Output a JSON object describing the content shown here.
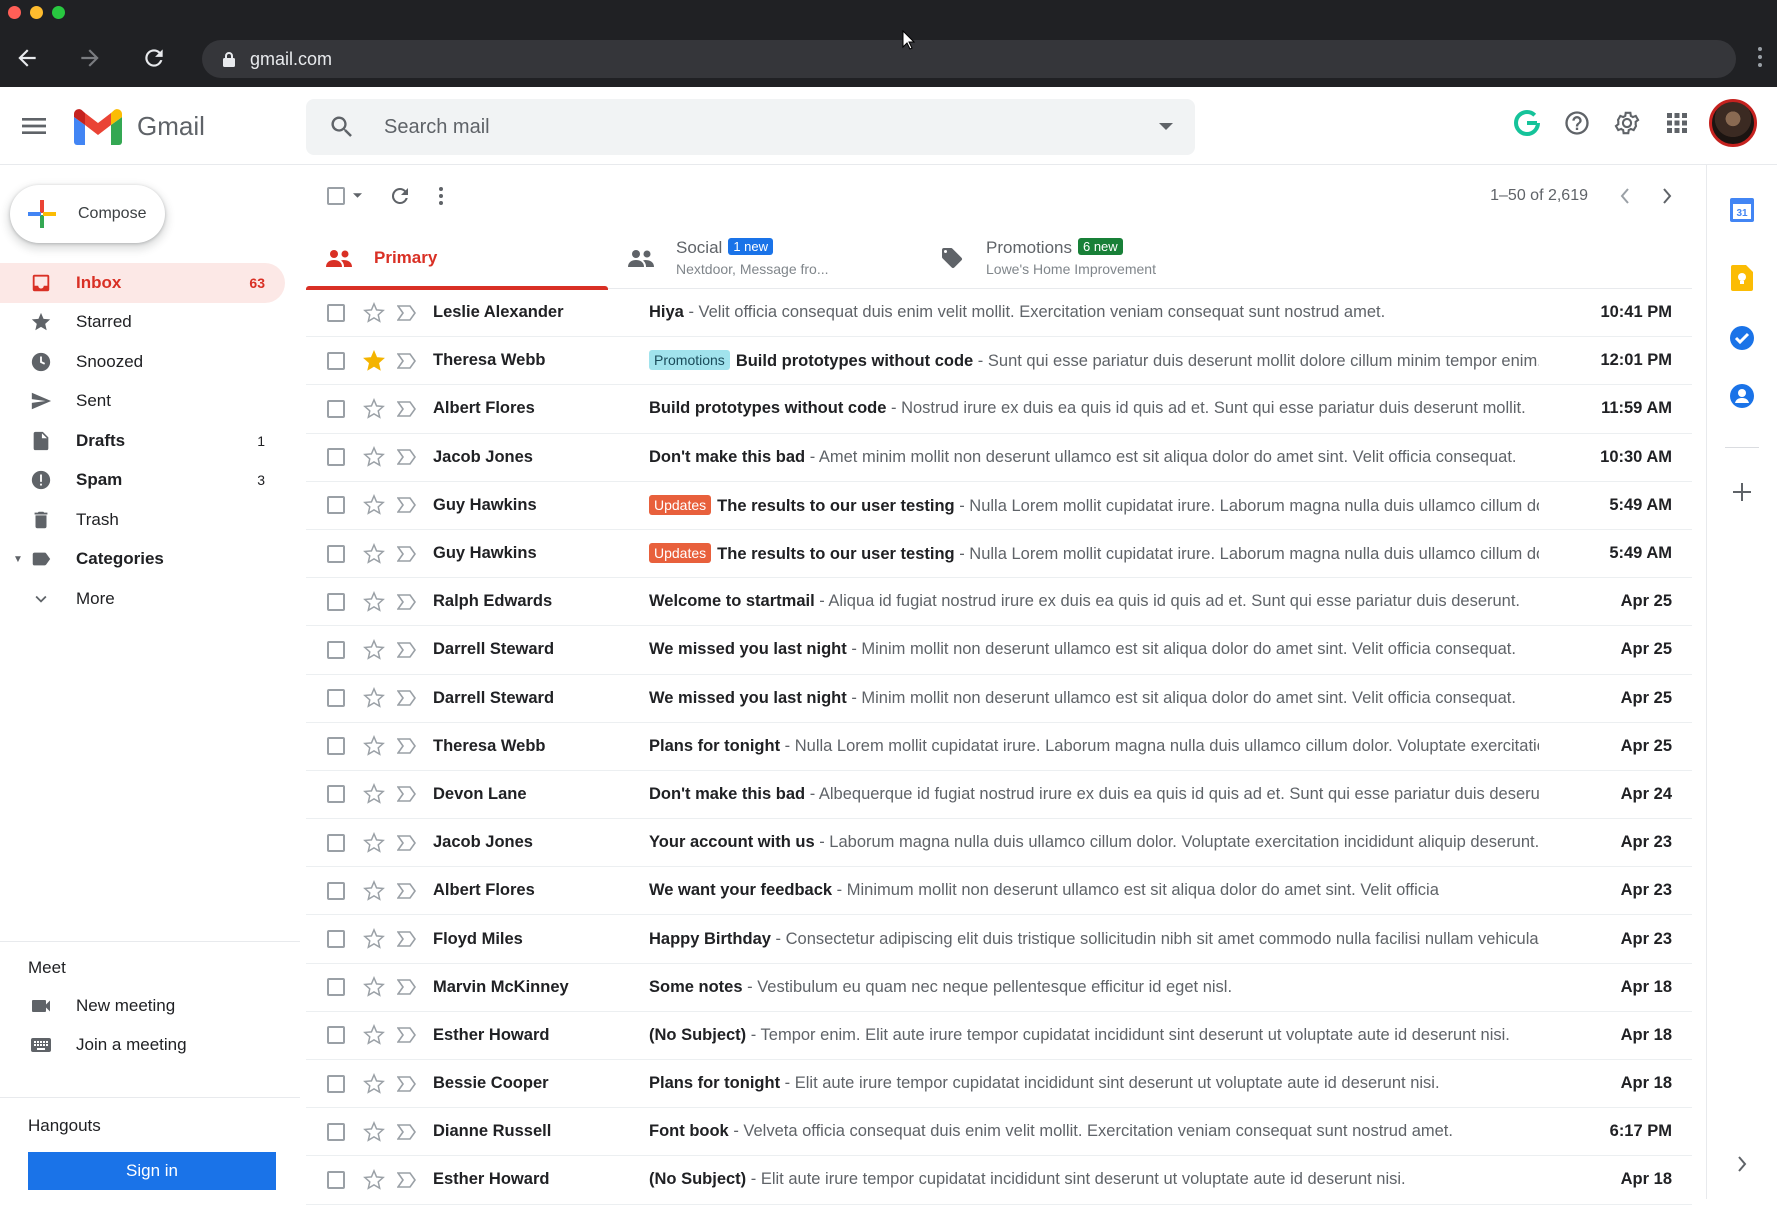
{
  "browser": {
    "url": "gmail.com"
  },
  "header": {
    "app_name": "Gmail",
    "search_placeholder": "Search mail"
  },
  "sidebar": {
    "compose_label": "Compose",
    "items": [
      {
        "label": "Inbox",
        "count": "63",
        "icon": "inbox-icon"
      },
      {
        "label": "Starred",
        "count": "",
        "icon": "star-icon"
      },
      {
        "label": "Snoozed",
        "count": "",
        "icon": "clock-icon"
      },
      {
        "label": "Sent",
        "count": "",
        "icon": "send-icon"
      },
      {
        "label": "Drafts",
        "count": "1",
        "icon": "file-icon"
      },
      {
        "label": "Spam",
        "count": "3",
        "icon": "alert-icon"
      },
      {
        "label": "Trash",
        "count": "",
        "icon": "trash-icon"
      },
      {
        "label": "Categories",
        "count": "",
        "icon": "label-icon"
      },
      {
        "label": "More",
        "count": "",
        "icon": "chevron-down-icon"
      }
    ],
    "meet": {
      "title": "Meet",
      "new_meeting": "New meeting",
      "join_meeting": "Join a meeting"
    },
    "hangouts": {
      "title": "Hangouts",
      "sign_in": "Sign in"
    }
  },
  "toolbar": {
    "pager": "1–50 of 2,619"
  },
  "tabs": {
    "primary": {
      "label": "Primary"
    },
    "social": {
      "label": "Social",
      "badge": "1 new",
      "sub": "Nextdoor, Message fro...",
      "badge_color": "#1a73e8"
    },
    "promotions": {
      "label": "Promotions",
      "badge": "6 new",
      "sub": "Lowe's Home Improvement",
      "badge_color": "#188038"
    }
  },
  "emails": [
    {
      "sender": "Leslie Alexander",
      "label": "",
      "subject": "Hiya",
      "snippet": " - Velit officia consequat duis enim velit mollit. Exercitation veniam consequat sunt nostrud amet.",
      "date": "10:41 PM",
      "starred": false
    },
    {
      "sender": "Theresa Webb",
      "label": "Promotions",
      "subject": "Build prototypes without code",
      "snippet": " - Sunt qui esse pariatur duis deserunt mollit dolore cillum minim tempor enim.",
      "date": "12:01 PM",
      "starred": true
    },
    {
      "sender": "Albert Flores",
      "label": "",
      "subject": "Build prototypes without code",
      "snippet": " - Nostrud irure ex duis ea quis id quis ad et. Sunt qui esse pariatur duis deserunt mollit.",
      "date": "11:59 AM",
      "starred": false
    },
    {
      "sender": "Jacob Jones",
      "label": "",
      "subject": "Don't make this bad",
      "snippet": " - Amet minim mollit non deserunt ullamco est sit aliqua dolor do amet sint. Velit officia consequat.",
      "date": "10:30 AM",
      "starred": false
    },
    {
      "sender": "Guy Hawkins",
      "label": "Updates",
      "subject": "The results to our user testing",
      "snippet": " - Nulla Lorem mollit cupidatat irure. Laborum magna nulla duis ullamco cillum dolor.",
      "date": "5:49 AM",
      "starred": false
    },
    {
      "sender": "Guy Hawkins",
      "label": "Updates",
      "subject": "The results to our user testing",
      "snippet": " - Nulla Lorem mollit cupidatat irure. Laborum magna nulla duis ullamco cillum dolor.",
      "date": "5:49 AM",
      "starred": false
    },
    {
      "sender": "Ralph Edwards",
      "label": "",
      "subject": "Welcome to startmail",
      "snippet": " - Aliqua id fugiat nostrud irure ex duis ea quis id quis ad et. Sunt qui esse pariatur duis deserunt.",
      "date": "Apr 25",
      "starred": false
    },
    {
      "sender": "Darrell Steward",
      "label": "",
      "subject": "We missed you last night",
      "snippet": " - Minim mollit non deserunt ullamco est sit aliqua dolor do amet sint. Velit officia consequat.",
      "date": "Apr 25",
      "starred": false
    },
    {
      "sender": "Darrell Steward",
      "label": "",
      "subject": "We missed you last night",
      "snippet": " - Minim mollit non deserunt ullamco est sit aliqua dolor do amet sint. Velit officia consequat.",
      "date": "Apr 25",
      "starred": false
    },
    {
      "sender": "Theresa Webb",
      "label": "",
      "subject": "Plans for tonight",
      "snippet": " - Nulla Lorem mollit cupidatat irure. Laborum magna nulla duis ullamco cillum dolor. Voluptate exercitation.",
      "date": "Apr 25",
      "starred": false
    },
    {
      "sender": "Devon Lane",
      "label": "",
      "subject": "Don't make this bad",
      "snippet": " - Albequerque id fugiat nostrud irure ex duis ea quis id quis ad et. Sunt qui esse pariatur duis deserunt.",
      "date": "Apr 24",
      "starred": false
    },
    {
      "sender": "Jacob Jones",
      "label": "",
      "subject": "Your account with us",
      "snippet": " - Laborum magna nulla duis ullamco cillum dolor. Voluptate exercitation incididunt aliquip deserunt.",
      "date": "Apr 23",
      "starred": false
    },
    {
      "sender": "Albert Flores",
      "label": "",
      "subject": "We want your feedback",
      "snippet": " - Minimum mollit non deserunt ullamco est sit aliqua dolor do amet sint. Velit officia",
      "date": "Apr 23",
      "starred": false
    },
    {
      "sender": "Floyd Miles",
      "label": "",
      "subject": "Happy Birthday",
      "snippet": " - Consectetur adipiscing elit duis tristique sollicitudin nibh sit amet commodo nulla facilisi nullam vehicula.",
      "date": "Apr 23",
      "starred": false
    },
    {
      "sender": "Marvin McKinney",
      "label": "",
      "subject": "Some notes",
      "snippet": " - Vestibulum eu quam nec neque pellentesque efficitur id eget nisl.",
      "date": "Apr 18",
      "starred": false
    },
    {
      "sender": "Esther Howard",
      "label": "",
      "subject": "(No Subject)",
      "snippet": " - Tempor enim. Elit aute irure tempor cupidatat incididunt sint deserunt ut voluptate aute id deserunt nisi.",
      "date": "Apr 18",
      "starred": false
    },
    {
      "sender": "Bessie Cooper",
      "label": "",
      "subject": "Plans for tonight",
      "snippet": " - Elit aute irure tempor cupidatat incididunt sint deserunt ut voluptate aute id deserunt nisi.",
      "date": "Apr 18",
      "starred": false
    },
    {
      "sender": "Dianne Russell",
      "label": "",
      "subject": "Font book",
      "snippet": " - Velveta officia consequat duis enim velit mollit. Exercitation veniam consequat sunt nostrud amet.",
      "date": "6:17 PM",
      "starred": false
    },
    {
      "sender": "Esther Howard",
      "label": "",
      "subject": "(No Subject)",
      "snippet": " - Elit aute irure tempor cupidatat incididunt sint deserunt ut voluptate aute id deserunt nisi.",
      "date": "Apr 18",
      "starred": false
    }
  ]
}
